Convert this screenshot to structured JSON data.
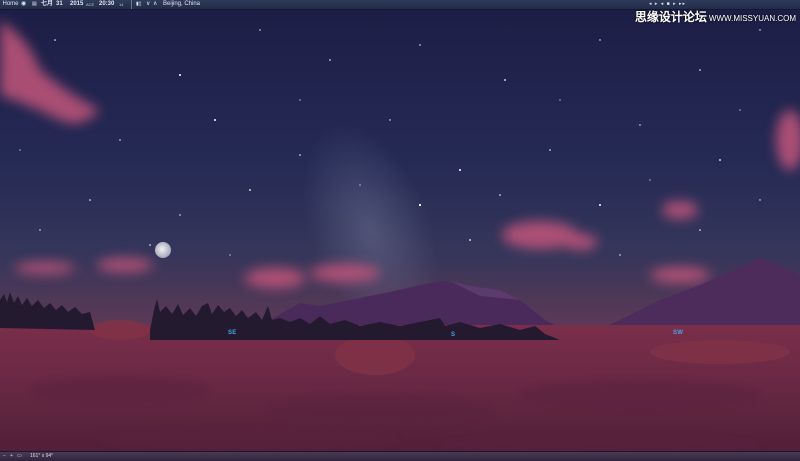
{
  "toolbar": {
    "home_label": "Home",
    "location_icon": "location-icon",
    "calendar_icon": "calendar-icon",
    "month": "七月",
    "day": "31",
    "year": "2015",
    "era": "ACE",
    "time": "20:30",
    "seconds": "14",
    "location": "Beijing, China",
    "right_controls": "◂ ▸ ◂ ■ ▸ ▸▸"
  },
  "watermark": {
    "text": "思缘设计论坛",
    "url": "WWW.MISSYUAN.COM"
  },
  "compass": {
    "se": "SE",
    "s": "S",
    "sw": "SW"
  },
  "bottombar": {
    "zoom_out": "−",
    "zoom_in": "+",
    "field_of_view": "161° x 94°"
  },
  "colors": {
    "sky_top": "#1d1f44",
    "sky_horizon": "#5a3656",
    "ground": "#6a2944",
    "compass_label": "#4aa3e8",
    "moon": "#d9d9e2"
  }
}
